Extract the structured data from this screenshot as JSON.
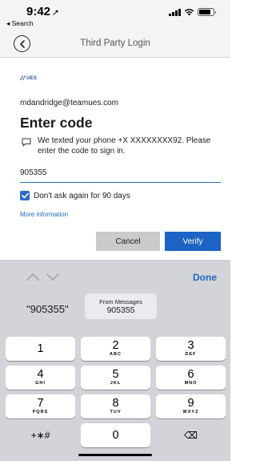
{
  "status_bar": {
    "time": "9:42",
    "back_app": "◂ Search",
    "battery_level": 0.85
  },
  "nav": {
    "title": "Third Party Login"
  },
  "content": {
    "logo_text": "UES",
    "email": "mdandridge@teamues.com",
    "heading": "Enter code",
    "message": "We texted your phone +X XXXXXXXX92. Please enter the code to sign in.",
    "code_value": "905355",
    "remember_label": "Don't ask again for 90 days",
    "remember_checked": true,
    "more_info": "More information",
    "cancel_label": "Cancel",
    "verify_label": "Verify"
  },
  "keyboard": {
    "done_label": "Done",
    "suggestion_quoted": "\"905355\"",
    "suggestion_from": "From Messages",
    "suggestion_code": "905355",
    "keys": [
      {
        "digit": "1",
        "letters": ""
      },
      {
        "digit": "2",
        "letters": "ABC"
      },
      {
        "digit": "3",
        "letters": "DEF"
      },
      {
        "digit": "4",
        "letters": "GHI"
      },
      {
        "digit": "5",
        "letters": "JKL"
      },
      {
        "digit": "6",
        "letters": "MNO"
      },
      {
        "digit": "7",
        "letters": "PQRS"
      },
      {
        "digit": "8",
        "letters": "TUV"
      },
      {
        "digit": "9",
        "letters": "WXYZ"
      },
      {
        "digit": "+∗#",
        "letters": ""
      },
      {
        "digit": "0",
        "letters": ""
      },
      {
        "digit": "⌫",
        "letters": ""
      }
    ]
  },
  "colors": {
    "accent": "#1c63c3",
    "link": "#1e67c0",
    "keyboard_bg": "#d2d4d9",
    "bar_bg": "#f4f4f4"
  }
}
